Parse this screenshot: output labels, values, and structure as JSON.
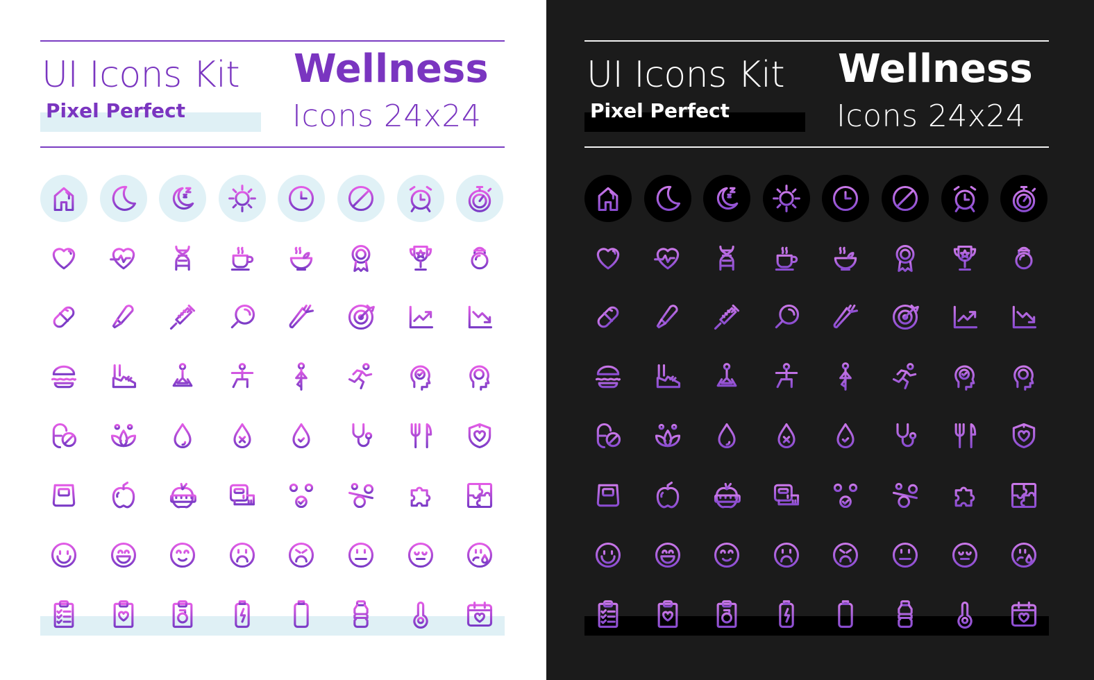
{
  "title": {
    "kit": "UI Icons Kit",
    "subtitle": "Pixel Perfect",
    "theme": "Wellness",
    "size": "Icons 24x24"
  },
  "colors": {
    "accent_purple": "#7a35c0",
    "gradient_top": "#e05ae8",
    "gradient_bottom": "#7b3fc4",
    "light_highlight": "#dff0f5",
    "dark_background": "#1b1b1b",
    "dark_highlight": "#000000"
  },
  "panels": [
    {
      "theme": "light"
    },
    {
      "theme": "dark"
    }
  ],
  "icons": [
    [
      "home-icon",
      "moon-icon",
      "sleep-icon",
      "sun-icon",
      "clock-icon",
      "prohibited-icon",
      "alarm-clock-icon",
      "stopwatch-icon"
    ],
    [
      "heart-icon",
      "heartbeat-icon",
      "dna-icon",
      "coffee-cup-icon",
      "bowl-of-food-icon",
      "award-badge-icon",
      "trophy-icon",
      "kettlebell-icon"
    ],
    [
      "pill-icon",
      "thermometer-icon",
      "syringe-icon",
      "magnifier-icon",
      "carrot-icon",
      "target-icon",
      "chart-up-icon",
      "chart-down-icon"
    ],
    [
      "burger-icon",
      "sneaker-icon",
      "meditation-icon",
      "yoga-lunge-icon",
      "yoga-tree-pose-icon",
      "running-icon",
      "mental-health-check-icon",
      "mental-health-alert-icon"
    ],
    [
      "no-pills-icon",
      "lotus-icon",
      "water-drop-icon",
      "water-drop-x-icon",
      "water-drop-check-icon",
      "stethoscope-icon",
      "fork-knife-icon",
      "heart-shield-icon"
    ],
    [
      "weight-scale-icon",
      "apple-icon",
      "apple-measure-icon",
      "measuring-tape-icon",
      "balance-check-icon",
      "imbalance-alert-icon",
      "puzzle-piece-icon",
      "puzzle-icon"
    ],
    [
      "smile-icon",
      "laugh-icon",
      "happy-icon",
      "sad-icon",
      "angry-icon",
      "neutral-icon",
      "tired-icon",
      "crying-icon"
    ],
    [
      "checklist-clipboard-icon",
      "health-clipboard-icon",
      "fitness-clipboard-icon",
      "battery-charge-icon",
      "battery-low-icon",
      "water-bottle-icon",
      "thermometer-low-icon",
      "calendar-heart-icon"
    ]
  ]
}
